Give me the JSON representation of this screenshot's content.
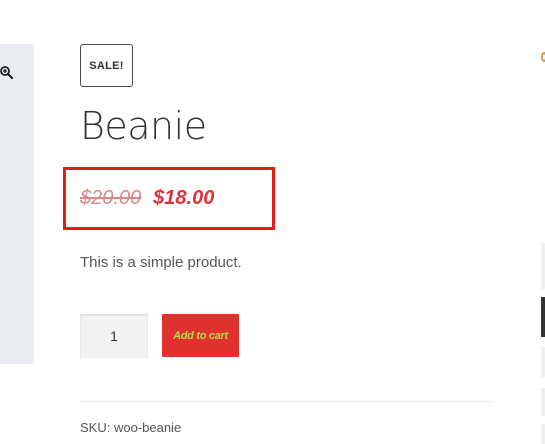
{
  "product": {
    "sale_badge": "SALE!",
    "title": "Beanie",
    "price": {
      "regular": "$20.00",
      "sale": "$18.00"
    },
    "short_description": "This is a simple product.",
    "quantity": "1",
    "add_to_cart_label": "Add to cart",
    "sku": "SKU: woo-beanie"
  },
  "gallery": {
    "zoom_icon": "zoom-in-icon"
  },
  "colors": {
    "sale_price": "#e0303a",
    "regular_price": "#d9888a",
    "button_bg": "#e1312f",
    "button_text": "#b8d94a",
    "highlight_border": "#e31b1b",
    "gallery_bg": "#e9edf1"
  }
}
